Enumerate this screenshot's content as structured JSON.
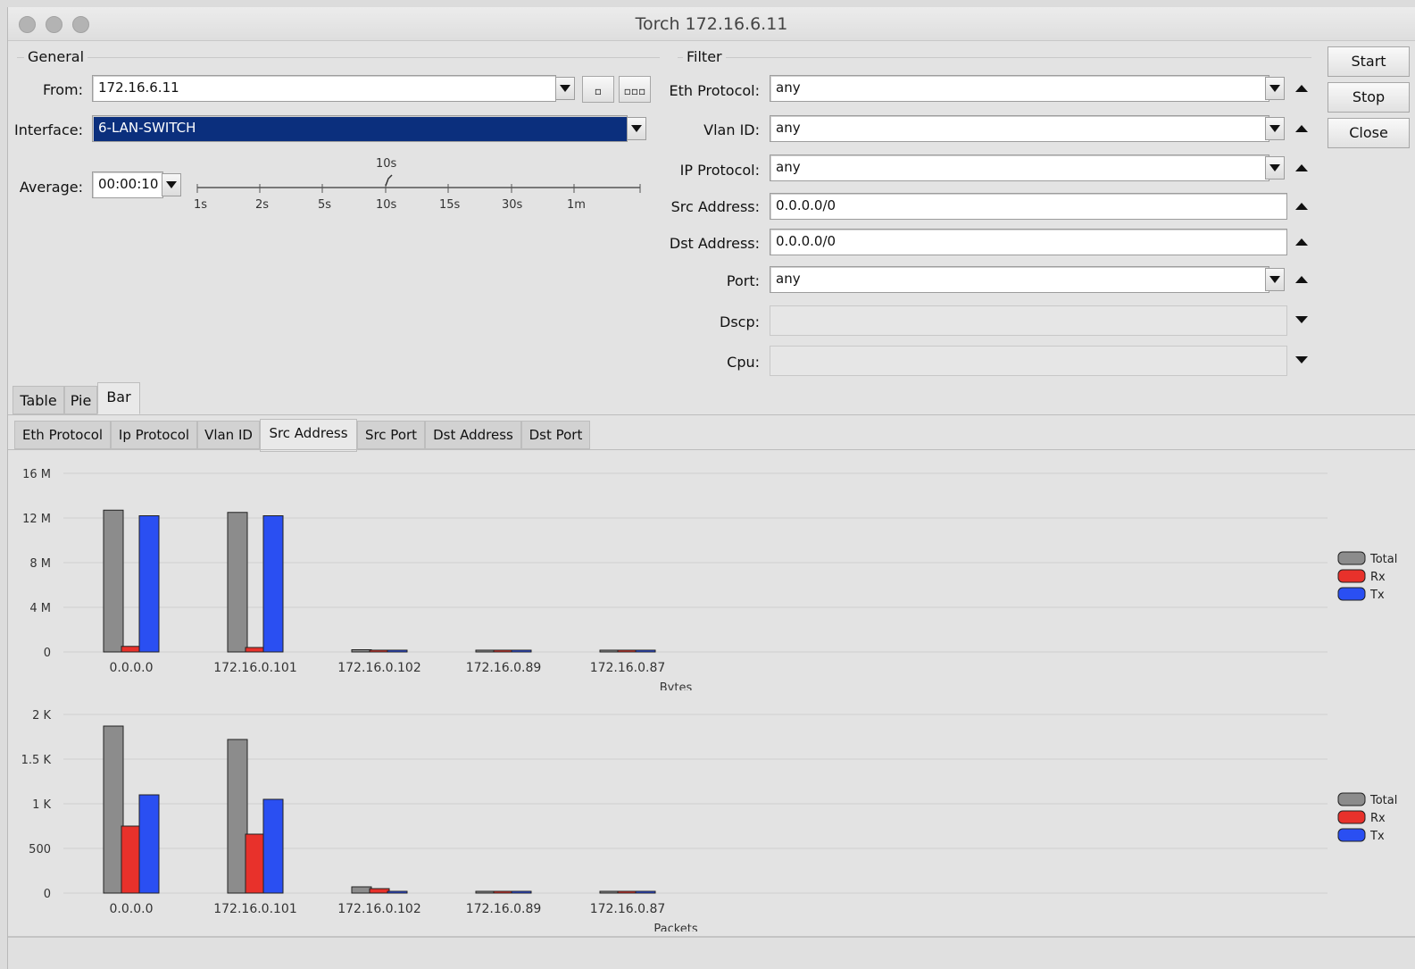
{
  "window": {
    "title": "Torch 172.16.6.11"
  },
  "general": {
    "label": "General",
    "from_label": "From:",
    "from_value": "172.16.6.11",
    "btn_single": "▫",
    "btn_multi": "▫▫▫",
    "interface_label": "Interface:",
    "interface_value": "6-LAN-SWITCH",
    "average_label": "Average:",
    "average_value": "00:00:10",
    "slider": {
      "current": "10s",
      "ticks": [
        "1s",
        "2s",
        "5s",
        "10s",
        "15s",
        "30s",
        "1m"
      ]
    }
  },
  "filter": {
    "label": "Filter",
    "eth_protocol_label": "Eth Protocol:",
    "eth_protocol_value": "any",
    "vlan_id_label": "Vlan ID:",
    "vlan_id_value": "any",
    "ip_protocol_label": "IP Protocol:",
    "ip_protocol_value": "any",
    "src_address_label": "Src Address:",
    "src_address_value": "0.0.0.0/0",
    "dst_address_label": "Dst Address:",
    "dst_address_value": "0.0.0.0/0",
    "port_label": "Port:",
    "port_value": "any",
    "dscp_label": "Dscp:",
    "dscp_value": "",
    "cpu_label": "Cpu:",
    "cpu_value": ""
  },
  "buttons": {
    "start": "Start",
    "stop": "Stop",
    "close": "Close"
  },
  "view_tabs": [
    "Table",
    "Pie",
    "Bar"
  ],
  "group_tabs": [
    "Eth Protocol",
    "Ip Protocol",
    "Vlan ID",
    "Src Address",
    "Src Port",
    "Dst Address",
    "Dst Port"
  ],
  "colors": {
    "total": "#8c8c8c",
    "rx": "#e8312b",
    "tx": "#2a4ff2",
    "selection": "#0b2f7d"
  },
  "chart_data": [
    {
      "type": "bar",
      "xlabel": "Bytes",
      "yticks": [
        "0",
        "4 M",
        "8 M",
        "12 M",
        "16 M"
      ],
      "ylim": [
        0,
        16000000
      ],
      "categories": [
        "0.0.0.0",
        "172.16.0.101",
        "172.16.0.102",
        "172.16.0.89",
        "172.16.0.87"
      ],
      "series": [
        {
          "name": "Total",
          "values": [
            12700000,
            12500000,
            200000,
            80000,
            50000
          ]
        },
        {
          "name": "Rx",
          "values": [
            500000,
            400000,
            100000,
            30000,
            20000
          ]
        },
        {
          "name": "Tx",
          "values": [
            12200000,
            12200000,
            100000,
            50000,
            30000
          ]
        }
      ],
      "legend": "right"
    },
    {
      "type": "bar",
      "xlabel": "Packets",
      "yticks": [
        "0",
        "500",
        "1 K",
        "1.5 K",
        "2 K"
      ],
      "ylim": [
        0,
        2000
      ],
      "categories": [
        "0.0.0.0",
        "172.16.0.101",
        "172.16.0.102",
        "172.16.0.89",
        "172.16.0.87"
      ],
      "series": [
        {
          "name": "Total",
          "values": [
            1870,
            1720,
            70,
            20,
            10
          ]
        },
        {
          "name": "Rx",
          "values": [
            750,
            660,
            50,
            10,
            6
          ]
        },
        {
          "name": "Tx",
          "values": [
            1100,
            1050,
            20,
            10,
            5
          ]
        }
      ],
      "legend": "right"
    }
  ]
}
